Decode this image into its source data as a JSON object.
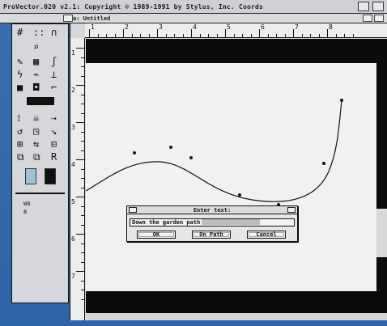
{
  "app": {
    "title": "ProVector.020 v2.1: Copyright © 1989-1991 by Stylus, Inc. Coords"
  },
  "document": {
    "window_title": "a: Untitled"
  },
  "rulers": {
    "horizontal_labels": [
      "1",
      "2",
      "3",
      "4",
      "5",
      "6",
      "7",
      "8"
    ],
    "vertical_labels": [
      "1",
      "2",
      "3",
      "4",
      "5",
      "6",
      "7"
    ]
  },
  "dialog": {
    "title": "Enter text:",
    "text_value": "Down the garden path",
    "buttons": {
      "ok": "OK",
      "on_path": "On Path",
      "cancel": "Cancel"
    }
  },
  "toolbox": {
    "mini_labels": [
      "W8",
      "B"
    ]
  },
  "colors": {
    "desktop": "#2f63a8",
    "swatch_fill": "#9cc2d9",
    "swatch_stroke": "#0f0f0f"
  }
}
